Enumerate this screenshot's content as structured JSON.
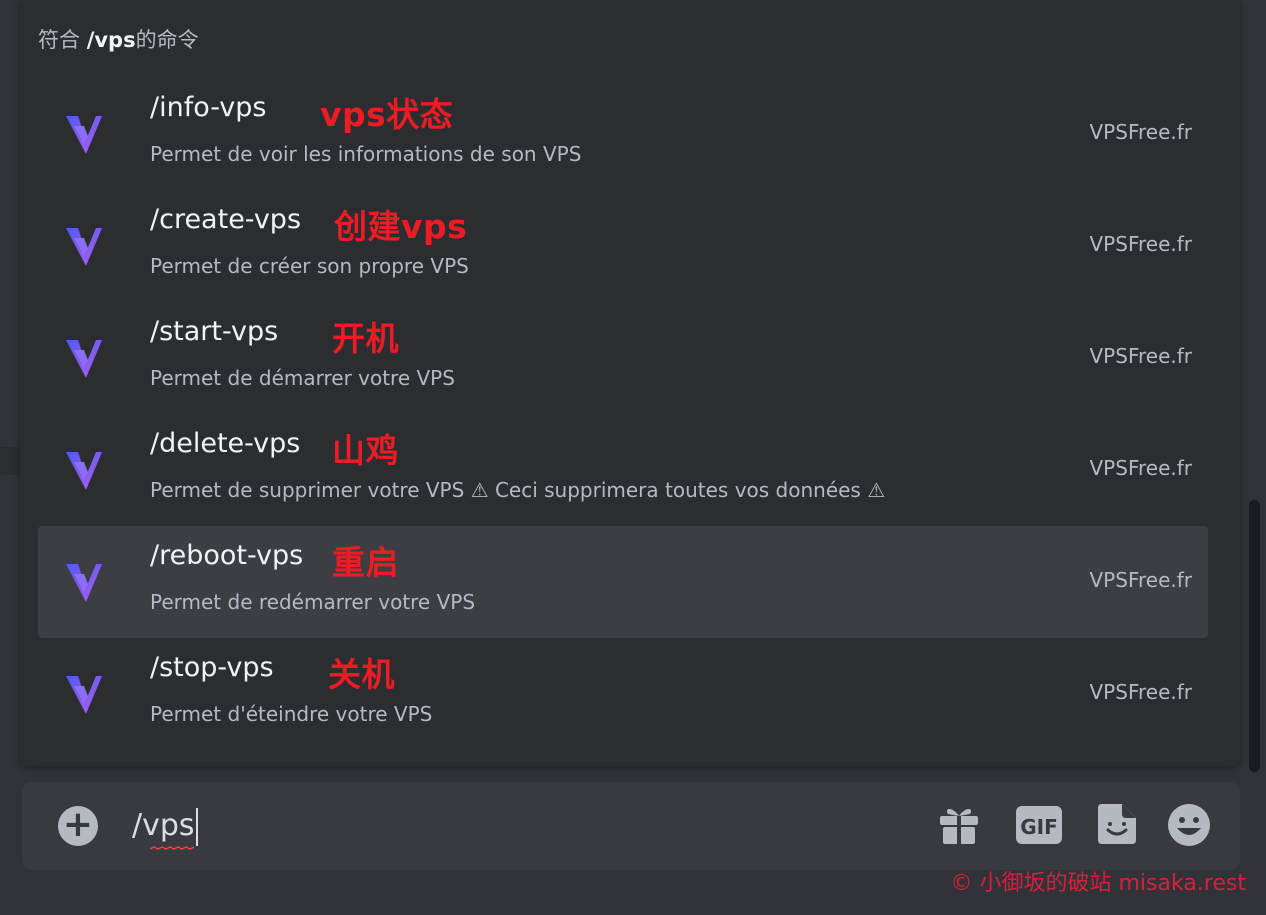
{
  "header": {
    "prefix": "符合 ",
    "query": "/vps",
    "suffix": "的命令"
  },
  "commands": [
    {
      "name": "/info-vps",
      "note": "vps状态",
      "description": "Permet de voir les informations de son VPS",
      "source": "VPSFree.fr",
      "selected": false
    },
    {
      "name": "/create-vps",
      "note": "创建vps",
      "description": "Permet de créer son propre VPS",
      "source": "VPSFree.fr",
      "selected": false
    },
    {
      "name": "/start-vps",
      "note": "开机",
      "description": "Permet de démarrer votre VPS",
      "source": "VPSFree.fr",
      "selected": false
    },
    {
      "name": "/delete-vps",
      "note": "山鸡",
      "description": "Permet de supprimer votre VPS ⚠ Ceci supprimera toutes vos données ⚠",
      "source": "VPSFree.fr",
      "selected": false
    },
    {
      "name": "/reboot-vps",
      "note": "重启",
      "description": "Permet de redémarrer votre VPS",
      "source": "VPSFree.fr",
      "selected": true
    },
    {
      "name": "/stop-vps",
      "note": "关机",
      "description": "Permet d'éteindre votre VPS",
      "source": "VPSFree.fr",
      "selected": false
    }
  ],
  "chatbar": {
    "input_value": "/vps",
    "plus_icon": "plus-circle-icon",
    "tools": [
      {
        "icon": "gift-icon"
      },
      {
        "icon": "gif-icon",
        "label": "GIF"
      },
      {
        "icon": "sticker-icon"
      },
      {
        "icon": "emoji-icon"
      }
    ]
  },
  "watermark": "© 小御坂的破站 misaka.rest",
  "colors": {
    "background": "#313338",
    "popup": "#2b2d31",
    "selected_row": "#3c3e44",
    "note_red": "#ec1c24",
    "icon_gradient_start": "#4a5cf0",
    "icon_gradient_end": "#b45cf0"
  }
}
